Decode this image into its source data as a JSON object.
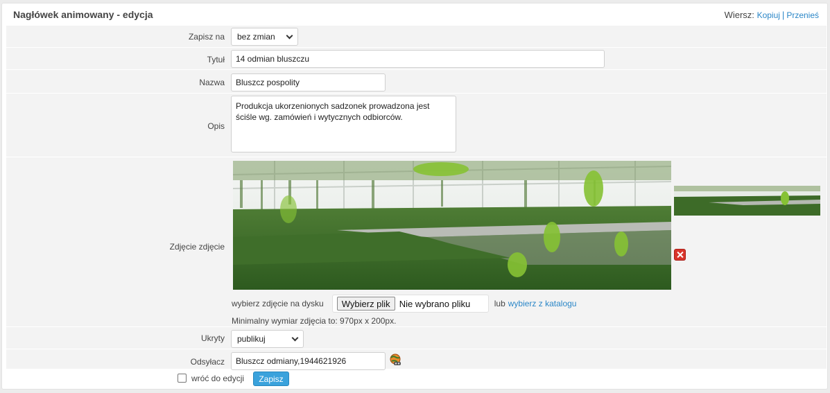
{
  "header": {
    "title": "Nagłówek animowany - edycja",
    "row_label": "Wiersz:",
    "copy_link": "Kopiuj",
    "separator": "|",
    "move_link": "Przenieś"
  },
  "fields": {
    "save_to": {
      "label": "Zapisz na",
      "value": "bez zmian"
    },
    "title": {
      "label": "Tytuł",
      "value": "14 odmian bluszczu"
    },
    "name": {
      "label": "Nazwa",
      "value": "Bluszcz pospolity"
    },
    "description": {
      "label": "Opis",
      "value": "Produkcja ukorzenionych sadzonek prowadzona jest ściśle wg. zamówień i wytycznych odbiorców."
    },
    "photo": {
      "label": "Zdjęcie zdjęcie",
      "choose_disk": "wybierz zdjęcie na dysku",
      "file_button": "Wybierz plik",
      "file_status": "Nie wybrano pliku",
      "or": "lub",
      "catalog_link": "wybierz z katalogu",
      "hint": "Minimalny wymiar zdjęcia to: 970px x 200px."
    },
    "hidden": {
      "label": "Ukryty",
      "value": "publikuj"
    },
    "link": {
      "label": "Odsyłacz",
      "value": "Bluszcz odmiany,1944621926"
    }
  },
  "footer": {
    "return_label": "wróć do edycji",
    "save_label": "Zapisz"
  },
  "colors": {
    "accent": "#3aa2dc",
    "link": "#2a86c7",
    "delete": "#d9342b"
  }
}
